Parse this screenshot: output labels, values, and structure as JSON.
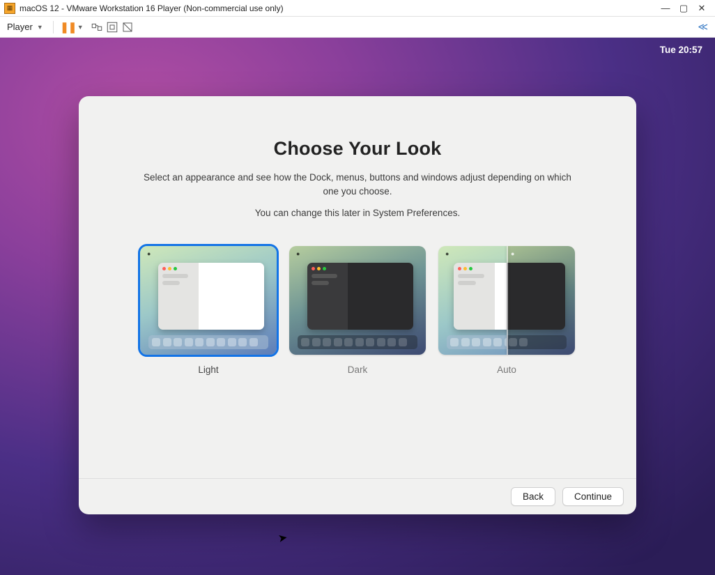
{
  "host": {
    "title": "macOS 12 - VMware Workstation 16 Player (Non-commercial use only)",
    "player_label": "Player"
  },
  "guest": {
    "clock": "Tue 20:57",
    "heading": "Choose Your Look",
    "description": "Select an appearance and see how the Dock, menus, buttons and windows adjust depending on which one you choose.",
    "note": "You can change this later in System Preferences.",
    "options": {
      "light": "Light",
      "dark": "Dark",
      "auto": "Auto"
    },
    "buttons": {
      "back": "Back",
      "continue": "Continue"
    }
  }
}
